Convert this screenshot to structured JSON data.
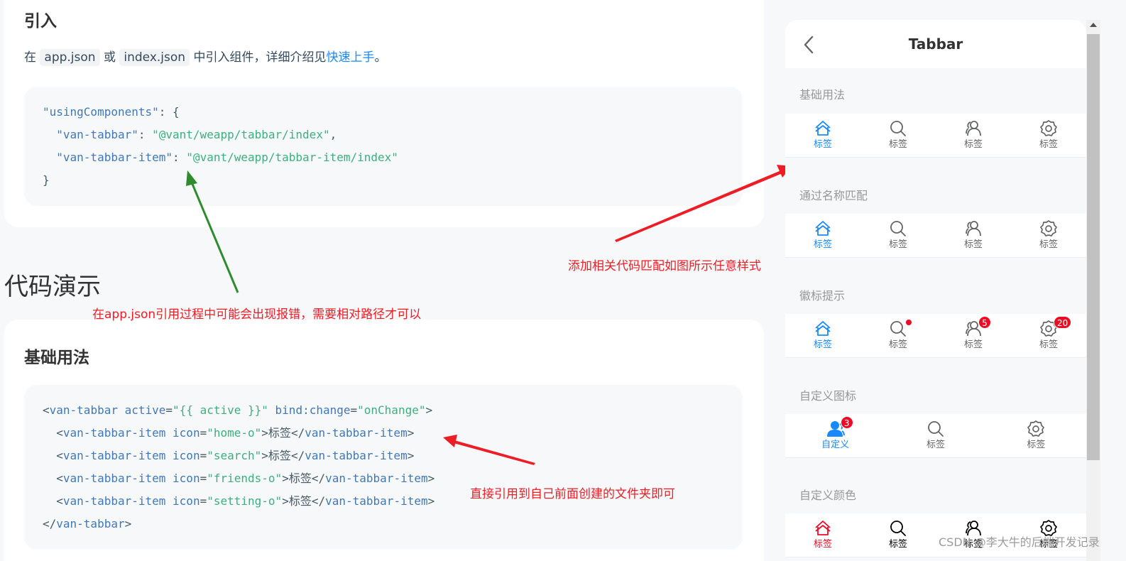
{
  "doc": {
    "intro_section_title": "引入",
    "intro_prefix": "在",
    "intro_code1": "app.json",
    "intro_or": "或",
    "intro_code2": "index.json",
    "intro_mid": "中引入组件，详细介绍见",
    "intro_link": "快速上手",
    "intro_end": "。",
    "code_top": {
      "line1_key": "\"usingComponents\"",
      "line1_rest": ": {",
      "line2_key": "\"van-tabbar\"",
      "line2_sep": ": ",
      "line2_val": "\"@vant/weapp/tabbar/index\"",
      "line2_end": ",",
      "line3_key": "\"van-tabbar-item\"",
      "line3_sep": ": ",
      "line3_val": "\"@vant/weapp/tabbar-item/index\"",
      "line4": "}"
    },
    "demo_heading": "代码演示",
    "basic_title": "基础用法",
    "code_bottom": {
      "l1_open": "<",
      "l1_tag": "van-tabbar",
      "l1_attr1": " active",
      "l1_eq1": "=",
      "l1_val1": "\"{{ active }}\"",
      "l1_attr2": " bind:change",
      "l1_eq2": "=",
      "l1_val2": "\"onChange\"",
      "l1_close": ">",
      "items": [
        {
          "icon": "\"home-o\"",
          "text": "标签"
        },
        {
          "icon": "\"search\"",
          "text": "标签"
        },
        {
          "icon": "\"friends-o\"",
          "text": "标签"
        },
        {
          "icon": "\"setting-o\"",
          "text": "标签"
        }
      ],
      "item_tag": "van-tabbar-item",
      "item_attr": " icon",
      "end_tag": "van-tabbar"
    }
  },
  "annotations": {
    "green_note": "在app.json引用过程中可能会出现报错，需要相对路径才可以",
    "right_note": "添加相关代码匹配如图所示任意样式",
    "bottom_note": "直接引用到自己前面创建的文件夹即可"
  },
  "phone": {
    "nav_title": "Tabbar",
    "sections": [
      {
        "title": "基础用法",
        "tabs": [
          "标签",
          "标签",
          "标签",
          "标签"
        ]
      },
      {
        "title": "通过名称匹配",
        "tabs": [
          "标签",
          "标签",
          "标签",
          "标签"
        ]
      },
      {
        "title": "徽标提示",
        "tabs": [
          "标签",
          "标签",
          "标签",
          "标签"
        ],
        "badges": [
          "5",
          "20"
        ]
      },
      {
        "title": "自定义图标",
        "tabs": [
          "自定义",
          "标签",
          "标签"
        ],
        "badge": "3"
      },
      {
        "title": "自定义颜色",
        "tabs": [
          "标签",
          "标签",
          "标签",
          "标签"
        ]
      }
    ]
  },
  "icons": [
    "back-icon",
    "home-icon",
    "search-icon",
    "friends-icon",
    "setting-icon",
    "user-icon"
  ],
  "colors": {
    "accent": "#1989fa",
    "danger": "#ee0a24",
    "annotation": "#ee1c25",
    "arrow_green": "#2e8b2e"
  },
  "watermark": "CSDN @李大牛的后端开发记录"
}
